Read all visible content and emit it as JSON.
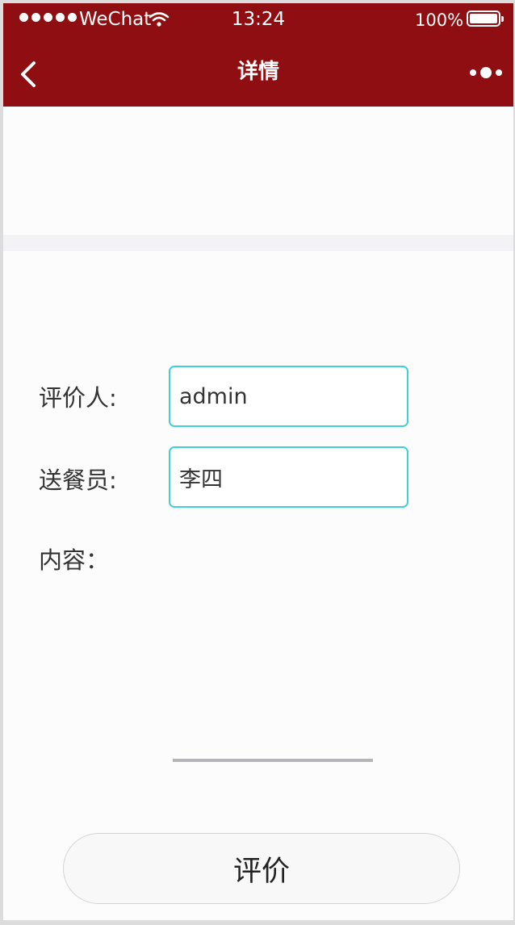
{
  "status_bar": {
    "carrier": "WeChat",
    "time": "13:24",
    "battery": "100%"
  },
  "nav": {
    "title": "详情"
  },
  "form": {
    "reviewer_label": "评价人:",
    "reviewer_value": "admin",
    "courier_label": "送餐员:",
    "courier_value": "李四",
    "content_label": "内容："
  },
  "actions": {
    "submit_label": "评价"
  },
  "colors": {
    "header": "#8f0e11",
    "field_border": "#3fd0d9",
    "background": "#fdfcfd"
  },
  "icons": [
    "signal-icon",
    "wifi-icon",
    "battery-icon",
    "back-icon",
    "more-icon"
  ]
}
